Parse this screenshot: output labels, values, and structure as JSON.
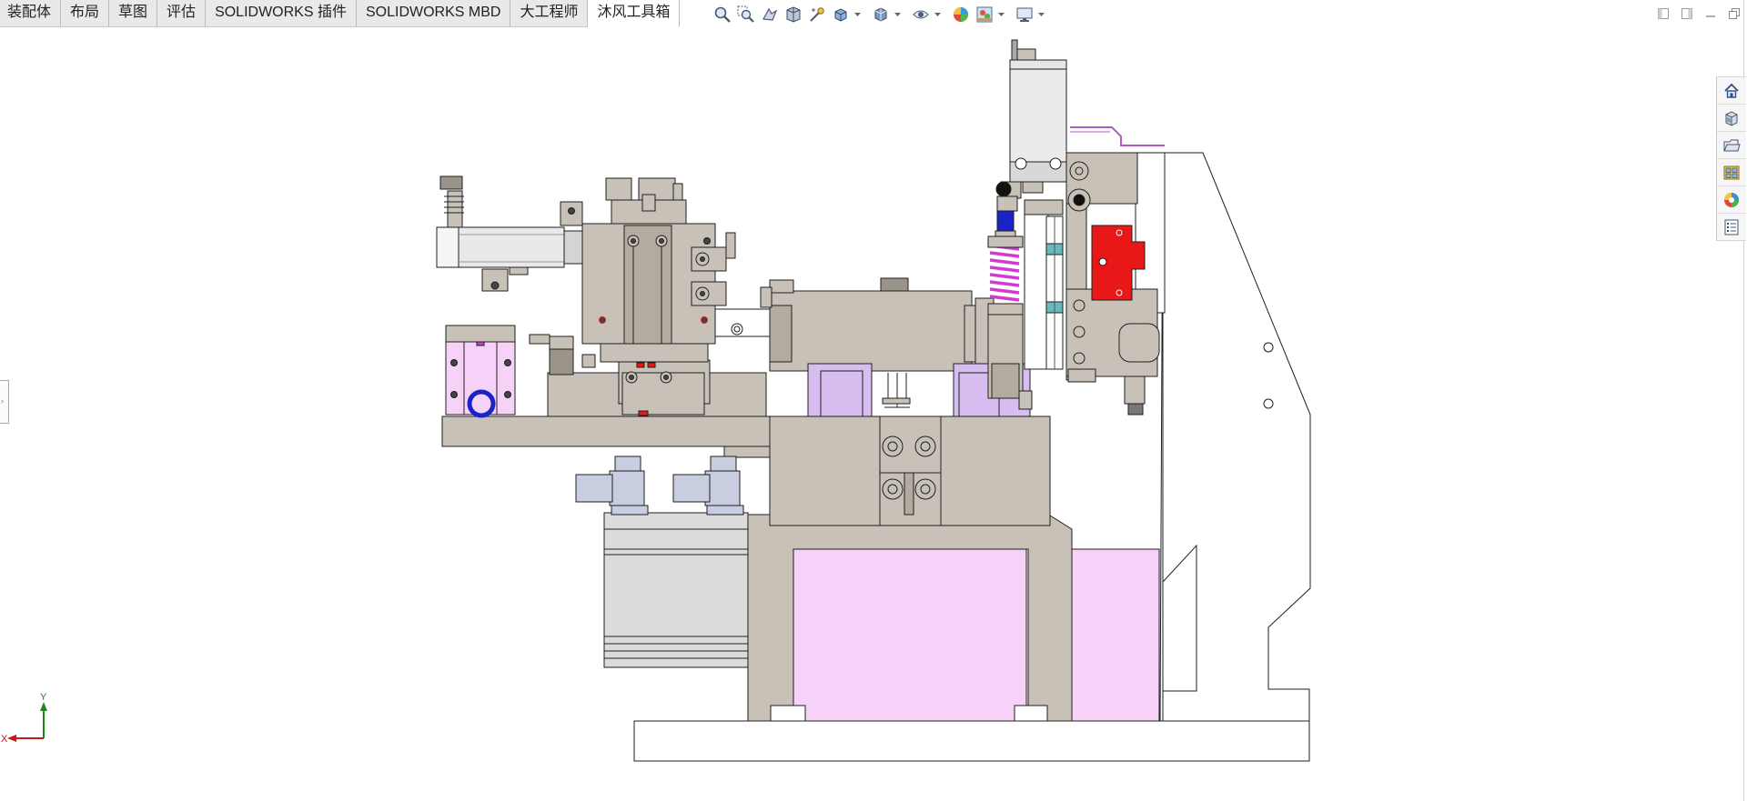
{
  "tabs": [
    {
      "label": "装配体"
    },
    {
      "label": "布局"
    },
    {
      "label": "草图"
    },
    {
      "label": "评估"
    },
    {
      "label": "SOLIDWORKS 插件"
    },
    {
      "label": "SOLIDWORKS MBD"
    },
    {
      "label": "大工程师"
    },
    {
      "label": "沐风工具箱"
    }
  ],
  "active_tab": "沐风工具箱",
  "hud_icons": [
    "zoom-to-fit-icon",
    "zoom-to-area-icon",
    "previous-view-icon",
    "section-view-icon",
    "dynamic-annotation-icon",
    "view-orientation-icon",
    "display-style-icon",
    "hide-show-items-icon",
    "edit-appearance-icon",
    "apply-scene-icon",
    "view-settings-icon"
  ],
  "window_controls": [
    "tile-left-icon",
    "tile-right-icon",
    "minimize-icon",
    "restore-icon"
  ],
  "task_pane": [
    "solidworks-resources-icon",
    "design-library-icon",
    "file-explorer-icon",
    "view-palette-icon",
    "appearances-scenes-icon",
    "custom-properties-icon"
  ],
  "triad": {
    "x_label": "X",
    "y_label": "Y"
  },
  "colors": {
    "part_gray": "#c8c1b8",
    "part_gray_dark": "#b3ab9f",
    "pink_body": "#f7d2f8",
    "lavender": "#d7bdf0",
    "spring_magenta": "#d23bd0",
    "red_block": "#e81818",
    "blue_ring": "#1a23c8",
    "teal": "#68b9bd",
    "fitting_blue": "#c9cde0"
  }
}
